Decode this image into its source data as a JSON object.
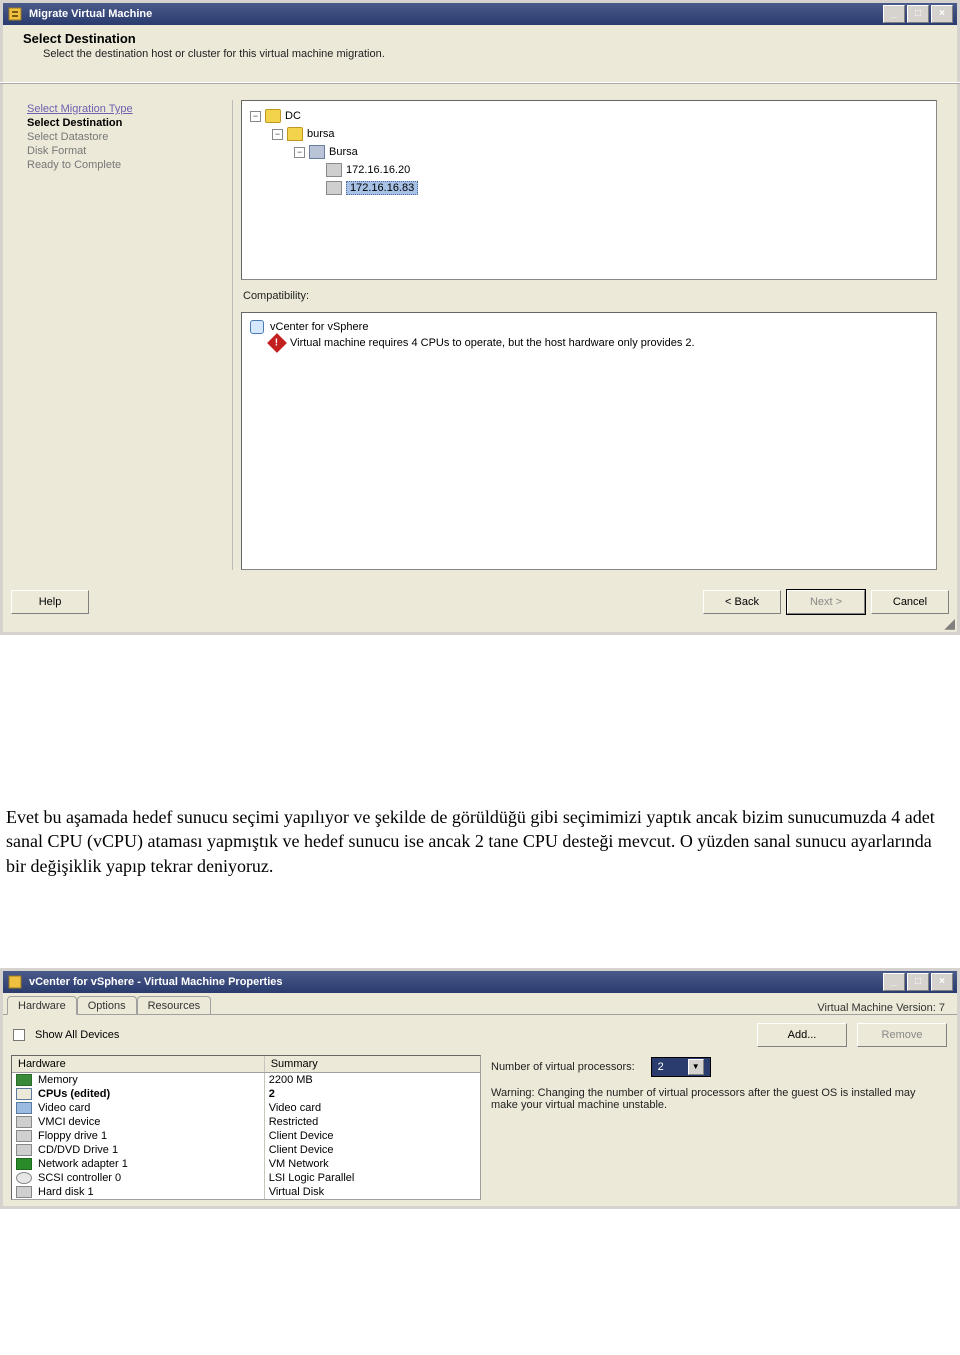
{
  "window1": {
    "title": "Migrate Virtual Machine",
    "header": "Select Destination",
    "subheader": "Select the destination host or cluster for this virtual machine migration.",
    "steps": [
      {
        "label": "Select Migration Type",
        "state": "done"
      },
      {
        "label": "Select Destination",
        "state": "current"
      },
      {
        "label": "Select Datastore",
        "state": "future"
      },
      {
        "label": "Disk Format",
        "state": "future"
      },
      {
        "label": "Ready to Complete",
        "state": "future"
      }
    ],
    "tree": {
      "l0": "DC",
      "l1": "bursa",
      "l2": "Bursa",
      "hosts": [
        "172.16.16.20",
        "172.16.16.83"
      ],
      "selected": "172.16.16.83"
    },
    "compat_label": "Compatibility:",
    "compat_item": "vCenter for vSphere",
    "compat_error": "Virtual machine requires 4 CPUs to operate, but the host hardware only provides 2.",
    "buttons": {
      "help": "Help",
      "back": "< Back",
      "next": "Next >",
      "cancel": "Cancel"
    }
  },
  "article_text": "Evet bu aşamada hedef sunucu seçimi yapılıyor ve şekilde de görüldüğü gibi seçimimizi yaptık ancak bizim sunucumuzda 4 adet sanal CPU (vCPU) ataması yapmıştık ve hedef sunucu ise ancak 2 tane CPU desteği mevcut. O yüzden sanal sunucu ayarlarında bir değişiklik yapıp tekrar deniyoruz.",
  "window2": {
    "title": "vCenter for vSphere - Virtual Machine Properties",
    "tabs": [
      "Hardware",
      "Options",
      "Resources"
    ],
    "vm_version": "Virtual Machine Version: 7",
    "show_all": "Show All Devices",
    "add": "Add...",
    "remove": "Remove",
    "headers": {
      "hw": "Hardware",
      "sum": "Summary"
    },
    "rows": [
      {
        "name": "Memory",
        "summary": "2200 MB",
        "icon": "mem"
      },
      {
        "name": "CPUs (edited)",
        "summary": "2",
        "icon": "cpu",
        "selected": true
      },
      {
        "name": "Video card",
        "summary": "Video card",
        "icon": "video"
      },
      {
        "name": "VMCI device",
        "summary": "Restricted",
        "icon": ""
      },
      {
        "name": "Floppy drive 1",
        "summary": "Client Device",
        "icon": ""
      },
      {
        "name": "CD/DVD Drive 1",
        "summary": "Client Device",
        "icon": ""
      },
      {
        "name": "Network adapter 1",
        "summary": "VM Network",
        "icon": "net"
      },
      {
        "name": "SCSI controller 0",
        "summary": "LSI Logic Parallel",
        "icon": "scsi"
      },
      {
        "name": "Hard disk 1",
        "summary": "Virtual Disk",
        "icon": ""
      }
    ],
    "proc_label": "Number of virtual processors:",
    "proc_value": "2",
    "proc_warning": "Warning: Changing the number of virtual processors after the guest OS is installed may make your virtual machine unstable."
  }
}
